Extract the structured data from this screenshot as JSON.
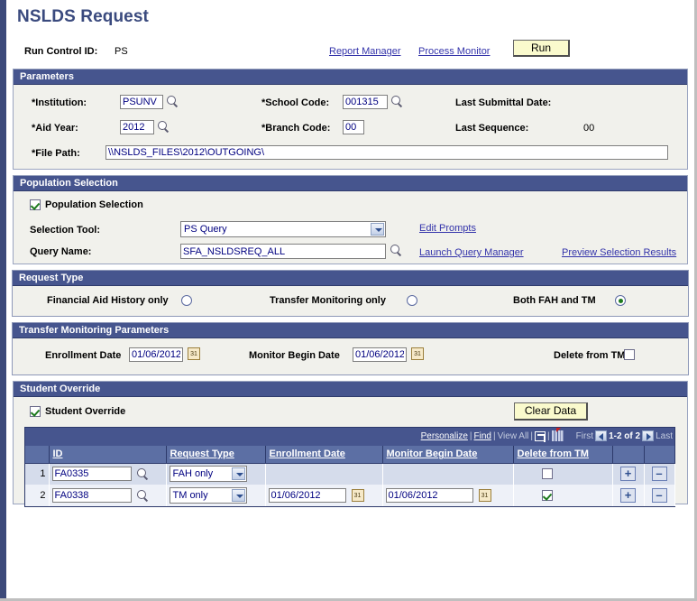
{
  "page": {
    "title": "NSLDS Request"
  },
  "runcontrol": {
    "label": "Run Control ID:",
    "value": "PS",
    "report_manager_link": "Report Manager",
    "process_monitor_link": "Process Monitor",
    "run_button": "Run"
  },
  "parameters": {
    "header": "Parameters",
    "institution_label": "*Institution:",
    "institution_value": "PSUNV",
    "aid_year_label": "*Aid Year:",
    "aid_year_value": "2012",
    "file_path_label": "*File Path:",
    "file_path_value": "\\\\NSLDS_FILES\\2012\\OUTGOING\\",
    "school_code_label": "*School Code:",
    "school_code_value": "001315",
    "branch_code_label": "*Branch Code:",
    "branch_code_value": "00",
    "last_submittal_label": "Last Submittal Date:",
    "last_submittal_value": "",
    "last_sequence_label": "Last Sequence:",
    "last_sequence_value": "00"
  },
  "population_selection": {
    "header": "Population Selection",
    "checkbox_label": "Population Selection",
    "checkbox_checked": true,
    "selection_tool_label": "Selection Tool:",
    "selection_tool_value": "PS Query",
    "selection_tool_options": [
      "PS Query"
    ],
    "query_name_label": "Query Name:",
    "query_name_value": "SFA_NSLDSREQ_ALL",
    "edit_prompts_link": "Edit Prompts",
    "launch_query_manager_link": "Launch Query Manager",
    "preview_selection_results_link": "Preview Selection Results"
  },
  "request_type": {
    "header": "Request Type",
    "options": [
      {
        "label": "Financial Aid History only",
        "selected": false
      },
      {
        "label": "Transfer Monitoring only",
        "selected": false
      },
      {
        "label": "Both FAH and TM",
        "selected": true
      }
    ]
  },
  "transfer_monitoring": {
    "header": "Transfer Monitoring Parameters",
    "enrollment_date_label": "Enrollment Date",
    "enrollment_date_value": "01/06/2012",
    "monitor_begin_date_label": "Monitor Begin Date",
    "monitor_begin_date_value": "01/06/2012",
    "delete_from_tm_label": "Delete from TM:",
    "delete_from_tm_checked": false
  },
  "student_override": {
    "header": "Student Override",
    "checkbox_label": "Student Override",
    "checkbox_checked": true,
    "clear_data_button": "Clear Data",
    "grid_toolbar": {
      "personalize": "Personalize",
      "find": "Find",
      "view_all": "View All",
      "sep": "|",
      "first": "First",
      "range": "1-2 of 2",
      "last": "Last"
    },
    "columns": [
      "",
      "ID",
      "Request Type",
      "Enrollment Date",
      "Monitor Begin Date",
      "Delete from TM",
      "",
      ""
    ],
    "rows": [
      {
        "num": "1",
        "id": "FA0335",
        "request_type": "FAH only",
        "enrollment_date": "",
        "monitor_begin_date": "",
        "delete_from_tm": false,
        "add_label": "+",
        "remove_label": "–"
      },
      {
        "num": "2",
        "id": "FA0338",
        "request_type": "TM only",
        "enrollment_date": "01/06/2012",
        "monitor_begin_date": "01/06/2012",
        "delete_from_tm": true,
        "add_label": "+",
        "remove_label": "–"
      }
    ],
    "request_type_options": [
      "FAH only",
      "TM only",
      "Both FAH and TM"
    ]
  },
  "colors": {
    "header_bar": "#46558e",
    "page_title": "#3a4a7e",
    "link": "#3333aa",
    "button": "#fafacd",
    "field_text": "#000080",
    "group_bg": "#f1f1ec",
    "row_odd": "#d5dceb",
    "row_even": "#eef1f8"
  }
}
